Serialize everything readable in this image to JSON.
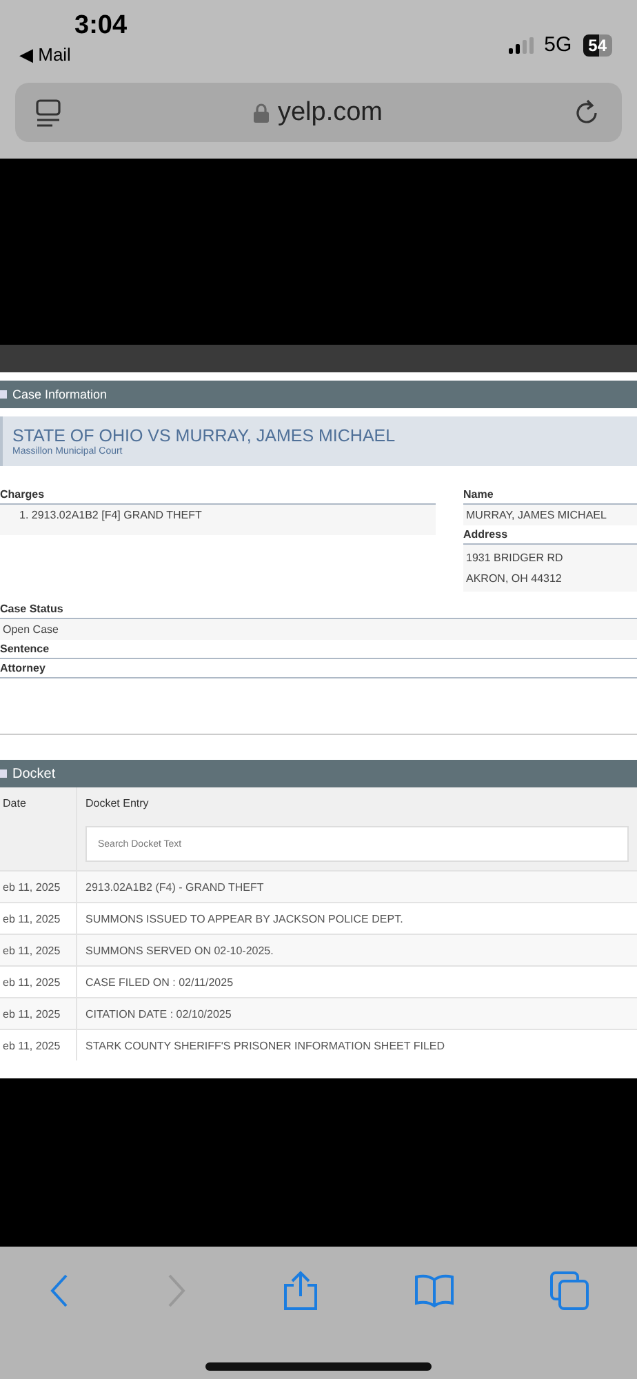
{
  "status_bar": {
    "time": "3:04",
    "back_app": "◀ Mail",
    "network": "5G",
    "battery": "54"
  },
  "address_bar": {
    "url": "yelp.com"
  },
  "case_information": {
    "header": "Case Information",
    "title": "STATE OF OHIO VS MURRAY, JAMES MICHAEL",
    "court": "Massillon Municipal Court",
    "charges_label": "Charges",
    "charges": [
      "1. 2913.02A1B2 [F4] GRAND THEFT"
    ],
    "name_label": "Name",
    "name": "MURRAY, JAMES MICHAEL",
    "address_label": "Address",
    "address_lines": [
      "1931 BRIDGER RD",
      "AKRON, OH 44312"
    ],
    "case_status_label": "Case Status",
    "case_status": "Open Case",
    "sentence_label": "Sentence",
    "attorney_label": "Attorney"
  },
  "docket": {
    "header": "Docket",
    "columns": [
      "Date",
      "Docket Entry"
    ],
    "search": {
      "placeholder": "Search Docket Text"
    },
    "rows": [
      {
        "date": "eb 11, 2025",
        "entry": "2913.02A1B2 (F4) - GRAND THEFT"
      },
      {
        "date": "eb 11, 2025",
        "entry": "SUMMONS ISSUED TO APPEAR BY JACKSON POLICE DEPT."
      },
      {
        "date": "eb 11, 2025",
        "entry": "SUMMONS SERVED ON 02-10-2025."
      },
      {
        "date": "eb 11, 2025",
        "entry": "CASE FILED ON : 02/11/2025"
      },
      {
        "date": "eb 11, 2025",
        "entry": "CITATION DATE : 02/10/2025"
      },
      {
        "date": "eb 11, 2025",
        "entry": "STARK COUNTY SHERIFF'S PRISONER INFORMATION SHEET FILED"
      }
    ]
  },
  "toolbar": {
    "back_enabled": true,
    "forward_enabled": false
  }
}
